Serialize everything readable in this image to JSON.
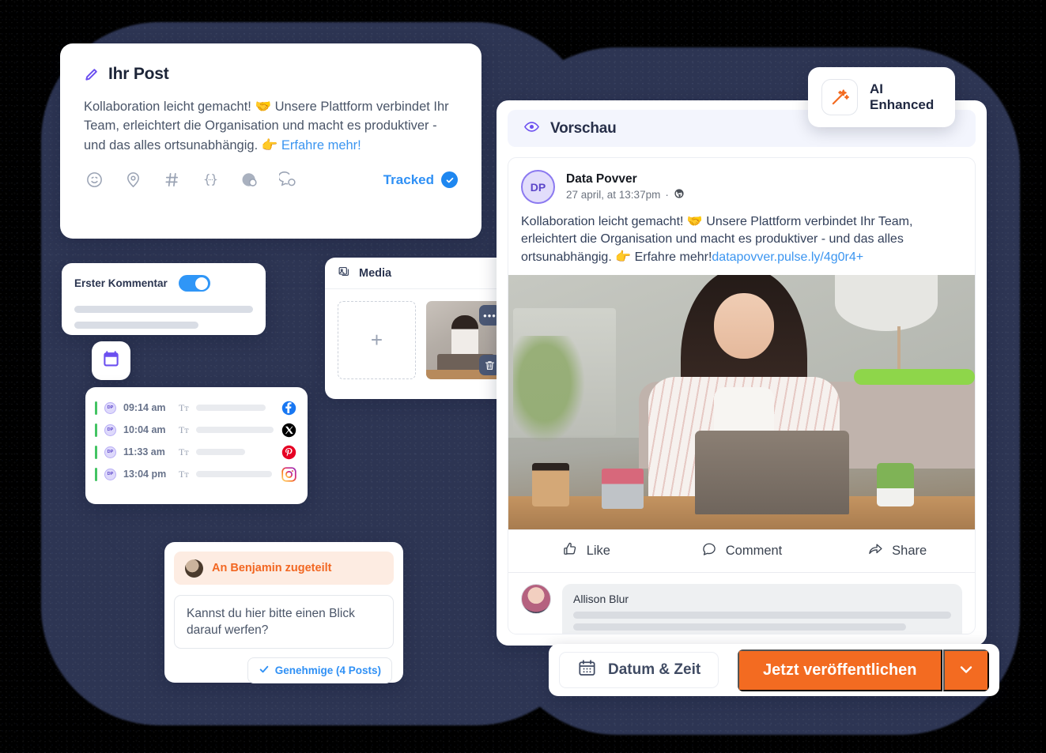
{
  "post_card": {
    "title": "Ihr Post",
    "icon": "pencil-icon",
    "body_text": "Kollaboration leicht gemacht! 🤝 Unsere Plattform verbindet Ihr Team, erleichtert die Organisation und macht es produktiver - und das alles ortsunabhängig. 👉 ",
    "body_link": "Erfahre mehr!",
    "tools": [
      "emoji-icon",
      "location-icon",
      "hashtag-icon",
      "variable-icon",
      "globe-icon",
      "chat-icon"
    ],
    "tracked_label": "Tracked"
  },
  "first_comment": {
    "label": "Erster Kommentar",
    "toggle_state": "on"
  },
  "schedule": {
    "calendar_icon": "calendar-icon",
    "rows": [
      {
        "avatar": "DP",
        "time": "09:14 am",
        "format": "Tт",
        "network": "facebook",
        "skeleton_width": 88
      },
      {
        "avatar": "DP",
        "time": "10:04 am",
        "format": "Tт",
        "network": "x",
        "skeleton_width": 98
      },
      {
        "avatar": "DP",
        "time": "11:33 am",
        "format": "Tт",
        "network": "pinterest",
        "skeleton_width": 62
      },
      {
        "avatar": "DP",
        "time": "13:04 pm",
        "format": "Tт",
        "network": "instagram",
        "skeleton_width": 96
      }
    ]
  },
  "media": {
    "title": "Media",
    "icon": "image-icon",
    "add_label": "+",
    "thumb_menu_icon": "dots-icon",
    "thumb_delete_icon": "trash-icon"
  },
  "assignment": {
    "pill_text": "An Benjamin zugeteilt",
    "note_text": "Kannst du hier bitte einen Blick darauf werfen?",
    "approve_label": "Genehmige (4 Posts)",
    "approve_icon": "check-icon"
  },
  "preview": {
    "header_title": "Vorschau",
    "header_icon": "eye-icon",
    "post": {
      "avatar_initials": "DP",
      "author": "Data Povver",
      "meta": "27 april, at 13:37pm",
      "meta_icon": "globe-icon",
      "text": "Kollaboration leicht gemacht!  🤝 Unsere Plattform verbindet Ihr Team, erleichtert die Organisation und macht es produktiver - und das alles ortsunabhängig. 👉 Erfahre mehr!",
      "url": "datapovver.pulse.ly/4g0r4+",
      "image_alt": "woman-at-laptop-photo"
    },
    "actions": [
      {
        "label": "Like",
        "icon": "thumbs-up-icon"
      },
      {
        "label": "Comment",
        "icon": "comment-bubble-icon"
      },
      {
        "label": "Share",
        "icon": "share-arrow-icon"
      }
    ],
    "comment": {
      "author": "Allison Blur",
      "skeleton_widths": [
        100,
        88,
        55
      ]
    }
  },
  "ai_badge": {
    "label": "AI Enhanced",
    "icon": "magic-wand-icon"
  },
  "action_bar": {
    "datetime_label": "Datum & Zeit",
    "datetime_icon": "calendar-icon",
    "publish_label": "Jetzt veröffentlichen",
    "caret_icon": "chevron-down-icon"
  },
  "colors": {
    "accent_orange": "#f36b21",
    "accent_blue": "#2f90f5",
    "purple": "#6b4ff0",
    "backdrop_navy": "#2d3553",
    "page_background": "#000000"
  }
}
